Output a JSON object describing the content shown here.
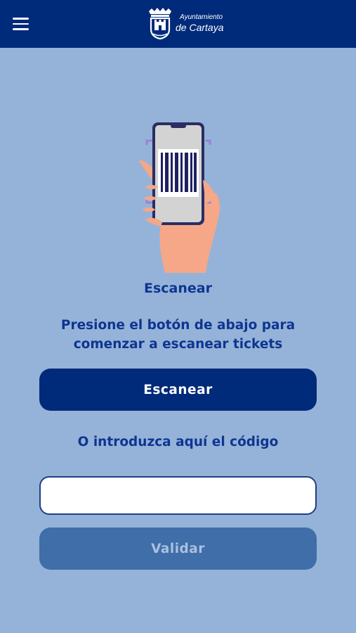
{
  "header": {
    "brand_line1": "Ayuntamiento",
    "brand_line2": "de Cartaya",
    "menu_icon": "hamburger-menu-icon",
    "logo_icon": "castle-crest-icon"
  },
  "main": {
    "illustration": "hand-holding-phone-scanning-barcode",
    "title": "Escanear",
    "instruction": "Presione el botón de abajo para comenzar a escanear tickets",
    "scan_button": "Escanear",
    "or_label": "O introduzca aquí el código",
    "code_input_value": "",
    "code_input_placeholder": "",
    "validate_button": "Validar"
  },
  "colors": {
    "header_bg": "#002a7a",
    "page_bg": "#95b3d8",
    "primary": "#002a7a",
    "text": "#0e3591",
    "disabled_button": "#3f6ea9"
  }
}
